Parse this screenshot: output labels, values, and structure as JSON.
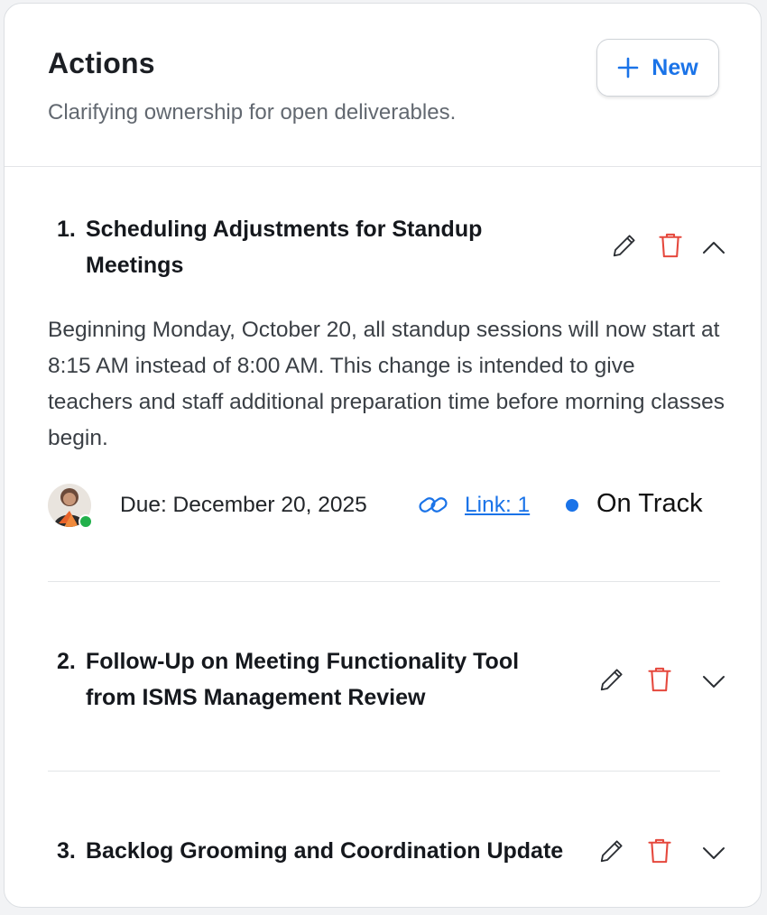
{
  "header": {
    "title": "Actions",
    "subtitle": "Clarifying ownership for open deliverables.",
    "new_button_label": "New"
  },
  "colors": {
    "accent": "#1a73e8",
    "danger": "#e5483d",
    "online": "#22b04b"
  },
  "actions": [
    {
      "number": "1.",
      "title_line1": "Scheduling Adjustments for Standup",
      "title_line2": "Meetings",
      "expanded": true,
      "description": "Beginning Monday, October 20, all standup sessions will now start at 8:15 AM instead of 8:00 AM. This change is intended to give teachers and staff additional preparation time before morning classes begin.",
      "due": "Due: December 20, 2025",
      "link_label": "Link: 1",
      "status": "On Track",
      "icons": [
        "pencil-icon",
        "trash-icon",
        "chevron-up-icon",
        "link-icon"
      ]
    },
    {
      "number": "2.",
      "title_line1": "Follow-Up on Meeting Functionality Tool",
      "title_line2": "from ISMS Management Review",
      "expanded": false,
      "icons": [
        "pencil-icon",
        "trash-icon",
        "chevron-down-icon"
      ]
    },
    {
      "number": "3.",
      "title_line1": "Backlog Grooming and Coordination Update",
      "expanded": false,
      "icons": [
        "pencil-icon",
        "trash-icon",
        "chevron-down-icon"
      ]
    }
  ]
}
